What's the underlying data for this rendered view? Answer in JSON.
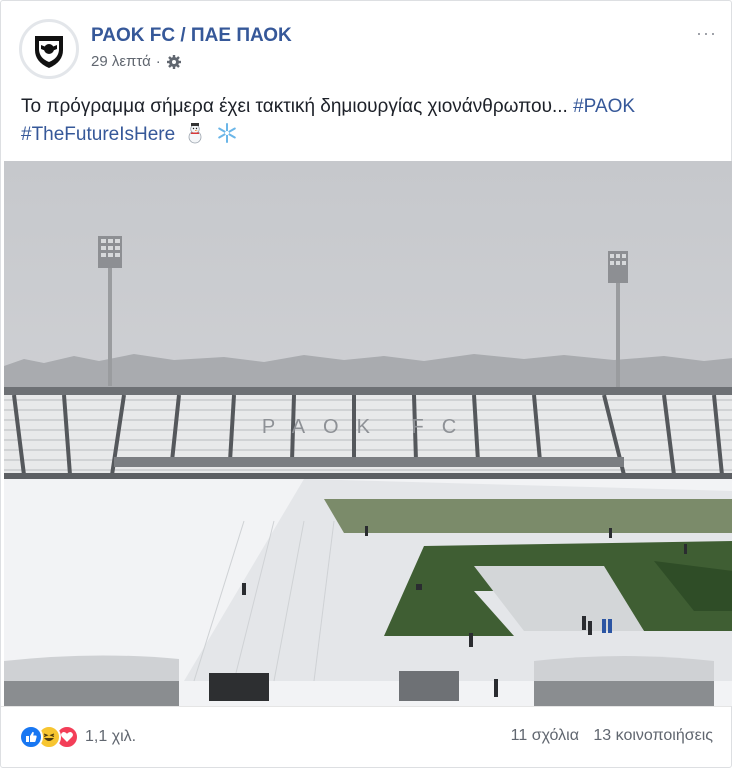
{
  "post": {
    "page_name": "PAOK FC / ΠΑΕ ΠΑΟΚ",
    "time": "29 λεπτά",
    "dot": "·",
    "privacy_icon": "gear-icon",
    "more_icon": "more-dots-icon",
    "more_label": "···",
    "text": "Το πρόγραμμα σήμερα έχει τακτική δημιουργίας χιονάνθρωπου...",
    "hashtags": [
      "#PAOK",
      "#TheFutureIsHere"
    ],
    "emojis": [
      "snowman-icon",
      "snowflake-icon"
    ]
  },
  "photo": {
    "subject": "snow-covered-stadium",
    "stand_lettering": "PAOK FC"
  },
  "footer": {
    "reaction_icons": [
      "like-icon",
      "laugh-icon",
      "love-icon"
    ],
    "reaction_count": "1,1 χιλ.",
    "comments": "11 σχόλια",
    "shares": "13 κοινοποιήσεις"
  },
  "colors": {
    "link": "#365899",
    "secondary_text": "#616770",
    "like_blue": "#1877f2",
    "haha_yellow": "#f7c530",
    "love_red": "#f33e58"
  }
}
